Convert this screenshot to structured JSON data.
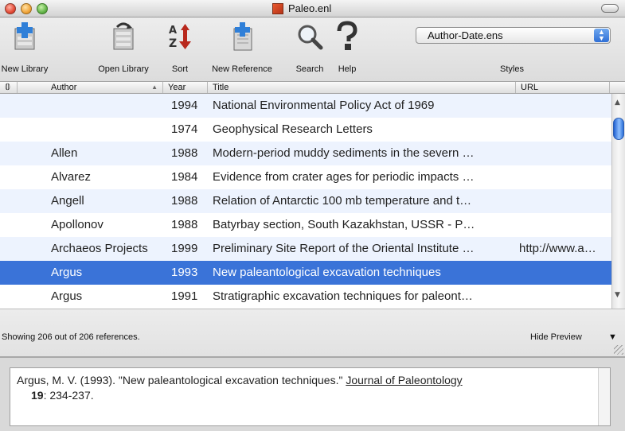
{
  "window": {
    "title": "Paleo.enl"
  },
  "toolbar": {
    "buttons": [
      {
        "label": "New Library",
        "icon": "new-library-icon"
      },
      {
        "label": "Open Library",
        "icon": "open-library-icon"
      },
      {
        "label": "Sort",
        "icon": "sort-az-icon"
      },
      {
        "label": "New Reference",
        "icon": "new-reference-icon"
      },
      {
        "label": "Search",
        "icon": "magnifier-icon"
      },
      {
        "label": "Help",
        "icon": "question-icon"
      }
    ],
    "styles": {
      "selected": "Author-Date.ens",
      "label": "Styles"
    }
  },
  "columns": {
    "attachment": "",
    "author": "Author",
    "year": "Year",
    "title": "Title",
    "url": "URL"
  },
  "rows": [
    {
      "author": "",
      "year": "1994",
      "title": "National Environmental Policy Act of 1969",
      "url": ""
    },
    {
      "author": "",
      "year": "1974",
      "title": "Geophysical Research Letters",
      "url": ""
    },
    {
      "author": "Allen",
      "year": "1988",
      "title": "Modern-period muddy sediments in the severn …",
      "url": ""
    },
    {
      "author": "Alvarez",
      "year": "1984",
      "title": "Evidence from crater ages for periodic impacts …",
      "url": ""
    },
    {
      "author": "Angell",
      "year": "1988",
      "title": "Relation of Antarctic 100 mb temperature and t…",
      "url": ""
    },
    {
      "author": "Apollonov",
      "year": "1988",
      "title": "Batyrbay section, South Kazakhstan, USSR - P…",
      "url": ""
    },
    {
      "author": "Archaeos Projects",
      "year": "1999",
      "title": "Preliminary Site Report of the Oriental Institute …",
      "url": "http://www.a…"
    },
    {
      "author": "Argus",
      "year": "1993",
      "title": "New paleantological excavation techniques",
      "url": ""
    },
    {
      "author": "Argus",
      "year": "1991",
      "title": "Stratigraphic excavation techniques for paleont…",
      "url": ""
    }
  ],
  "selected_row_index": 7,
  "status": {
    "text": "Showing 206 out of 206 references.",
    "hide_preview": "Hide Preview"
  },
  "preview": {
    "line1_prefix": "Argus, M. V. (1993). \"New paleantological excavation techniques.\" ",
    "journal": "Journal of Paleontology",
    "volume": "19",
    "pages": ": 234-237."
  },
  "colors": {
    "selection": "#3a73d8",
    "alt_row": "#edf3fe"
  }
}
